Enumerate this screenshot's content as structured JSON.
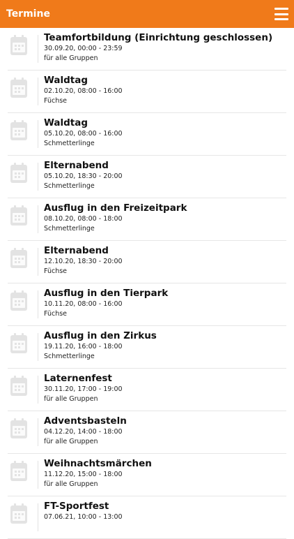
{
  "header": {
    "title": "Termine",
    "menu_icon": "hamburger-menu-icon"
  },
  "colors": {
    "accent": "#f07a1a"
  },
  "events": [
    {
      "title": "Teamfortbildung (Einrichtung geschlossen)",
      "date": "30.09.20, 00:00 - 23:59",
      "group": "für alle Gruppen"
    },
    {
      "title": "Waldtag",
      "date": "02.10.20, 08:00 - 16:00",
      "group": "Füchse"
    },
    {
      "title": "Waldtag",
      "date": "05.10.20, 08:00 - 16:00",
      "group": "Schmetterlinge"
    },
    {
      "title": "Elternabend",
      "date": "05.10.20, 18:30 - 20:00",
      "group": "Schmetterlinge"
    },
    {
      "title": "Ausflug in den Freizeitpark",
      "date": "08.10.20, 08:00 - 18:00",
      "group": "Schmetterlinge"
    },
    {
      "title": "Elternabend",
      "date": "12.10.20, 18:30 - 20:00",
      "group": "Füchse"
    },
    {
      "title": "Ausflug in den Tierpark",
      "date": "10.11.20, 08:00 - 16:00",
      "group": "Füchse"
    },
    {
      "title": "Ausflug in den Zirkus",
      "date": "19.11.20, 16:00 - 18:00",
      "group": "Schmetterlinge"
    },
    {
      "title": "Laternenfest",
      "date": "30.11.20, 17:00 - 19:00",
      "group": "für alle Gruppen"
    },
    {
      "title": "Adventsbasteln",
      "date": "04.12.20, 14:00 - 18:00",
      "group": "für alle Gruppen"
    },
    {
      "title": "Weihnachtsmärchen",
      "date": "11.12.20, 15:00 - 18:00",
      "group": "für alle Gruppen"
    },
    {
      "title": "FT-Sportfest",
      "date": "07.06.21, 10:00 - 13:00",
      "group": ""
    }
  ]
}
